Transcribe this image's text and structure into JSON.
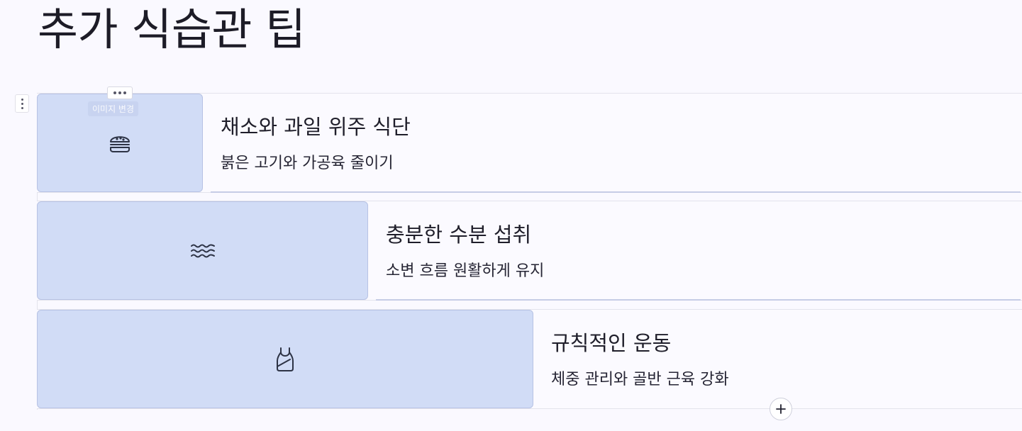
{
  "page": {
    "title": "추가 식습관 팁"
  },
  "items": [
    {
      "title": "채소와 과일 위주 식단",
      "description": "붉은 고기와 가공육 줄이기",
      "icon": "burger-icon"
    },
    {
      "title": "충분한 수분 섭취",
      "description": "소변 흐름 원활하게 유지",
      "icon": "water-waves-icon"
    },
    {
      "title": "규칙적인 운동",
      "description": "체중 관리와 골반 근육 강화",
      "icon": "tank-top-icon"
    }
  ],
  "toolbar": {
    "hover_badge": "이미지 변경"
  },
  "colors": {
    "background": "#faf9ff",
    "image_fill": "#d1dcf6",
    "image_border": "#b7c2e4",
    "text": "#1f1e2a",
    "underline": "#c6cce6"
  }
}
